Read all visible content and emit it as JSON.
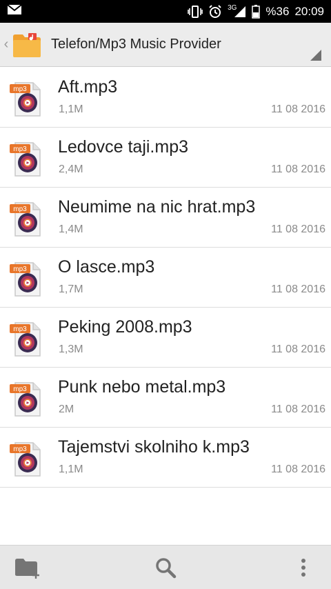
{
  "status_bar": {
    "network": "3G",
    "battery": "%36",
    "time": "20:09",
    "icons": [
      "mail-icon",
      "vibrate-icon",
      "alarm-icon",
      "signal-icon",
      "battery-icon"
    ]
  },
  "header": {
    "path": "Telefon/Mp3 Music Provider",
    "icon": "music-folder-icon"
  },
  "files": [
    {
      "name": "Aft.mp3",
      "size": "1,1M",
      "date": "11 08 2016",
      "badge": "mp3"
    },
    {
      "name": "Ledovce taji.mp3",
      "size": "2,4M",
      "date": "11 08 2016",
      "badge": "mp3"
    },
    {
      "name": "Neumime na nic hrat.mp3",
      "size": "1,4M",
      "date": "11 08 2016",
      "badge": "mp3"
    },
    {
      "name": "O lasce.mp3",
      "size": "1,7M",
      "date": "11 08 2016",
      "badge": "mp3"
    },
    {
      "name": "Peking 2008.mp3",
      "size": "1,3M",
      "date": "11 08 2016",
      "badge": "mp3"
    },
    {
      "name": "Punk nebo metal.mp3",
      "size": "2M",
      "date": "11 08 2016",
      "badge": "mp3"
    },
    {
      "name": "Tajemstvi skolniho k.mp3",
      "size": "1,1M",
      "date": "11 08 2016",
      "badge": "mp3"
    }
  ],
  "toolbar": {
    "icons": [
      "new-folder-icon",
      "search-icon",
      "more-options-icon"
    ]
  },
  "colors": {
    "accent_orange": "#e8762b",
    "folder_orange": "#f5a623",
    "toolbar_gray": "#e7e7e7",
    "icon_gray": "#757575"
  }
}
